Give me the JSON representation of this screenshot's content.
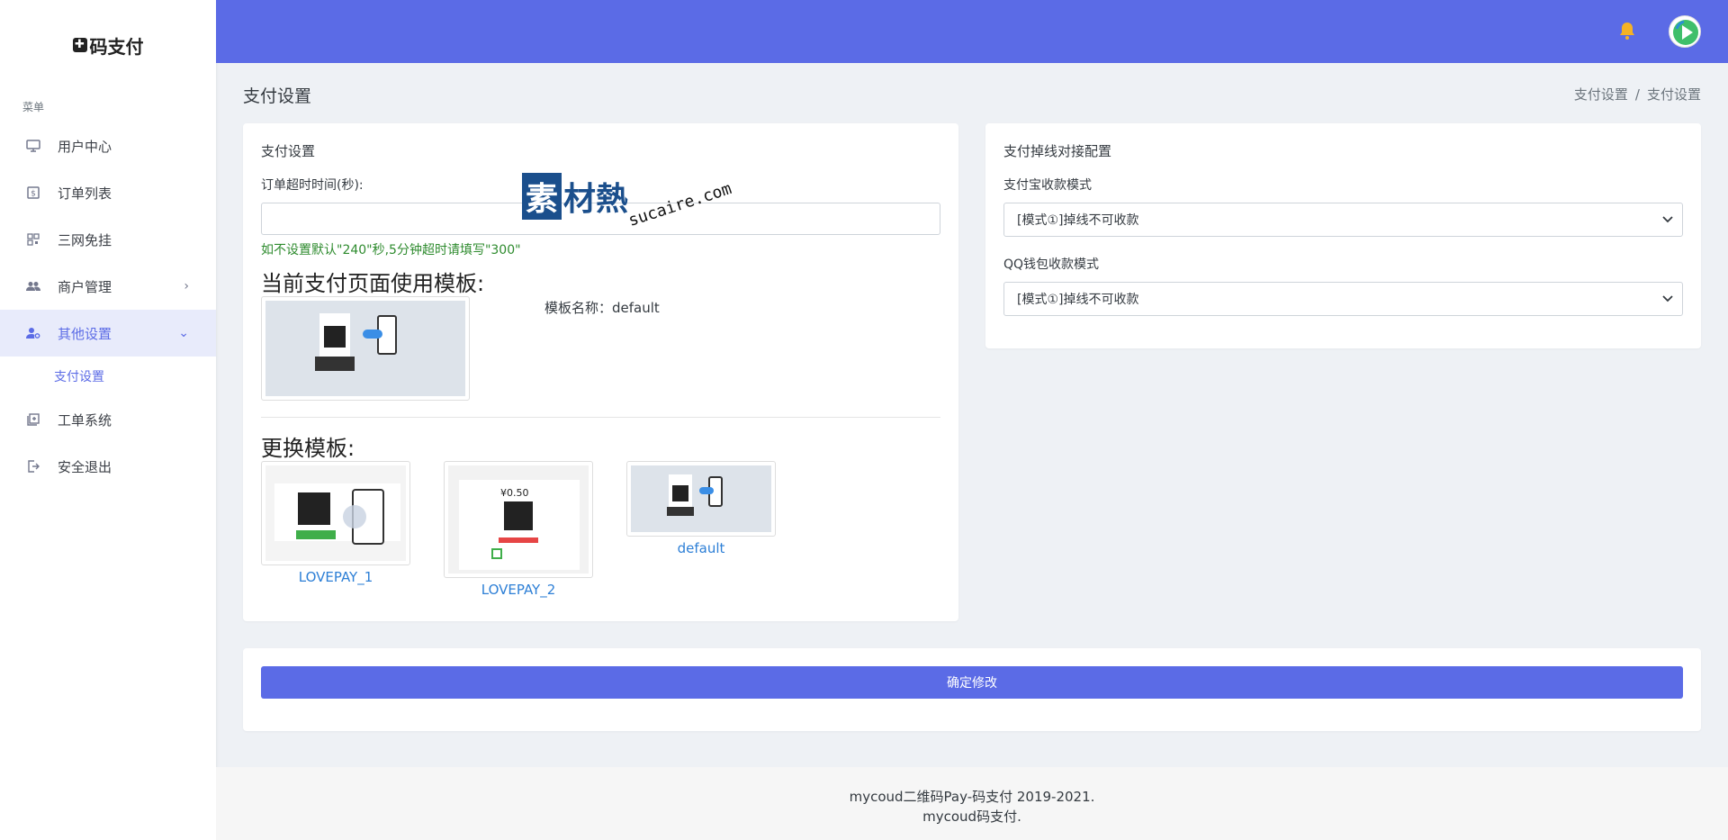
{
  "brand": {
    "name": "码支付",
    "mark": "✚"
  },
  "sidebar": {
    "menu_title": "菜单",
    "items": [
      {
        "label": "用户中心",
        "icon": "monitor-icon"
      },
      {
        "label": "订单列表",
        "icon": "dollar-receipt-icon"
      },
      {
        "label": "三网免挂",
        "icon": "qrcode-icon"
      },
      {
        "label": "商户管理",
        "icon": "users-icon"
      },
      {
        "label": "其他设置",
        "icon": "user-settings-icon"
      },
      {
        "label": "工单系统",
        "icon": "ticket-icon"
      },
      {
        "label": "安全退出",
        "icon": "logout-icon"
      }
    ],
    "submenu": {
      "label": "支付设置"
    }
  },
  "header": {
    "accent": "#5b6be6"
  },
  "page": {
    "title": "支付设置",
    "breadcrumb": [
      "支付设置",
      "支付设置"
    ],
    "breadcrumb_sep": "/"
  },
  "pay_settings": {
    "card_title": "支付设置",
    "timeout_label": "订单超时时间(秒):",
    "timeout_value": "",
    "timeout_help": "如不设置默认\"240\"秒,5分钟超时请填写\"300\"",
    "current_heading": "当前支付页面使用模板:",
    "template_name_label": "模板名称：default",
    "change_heading": "更换模板:",
    "templates": [
      {
        "name": "LOVEPAY_1"
      },
      {
        "name": "LOVEPAY_2",
        "amount": "¥0.50"
      },
      {
        "name": "default"
      }
    ]
  },
  "offline_config": {
    "card_title": "支付掉线对接配置",
    "alipay_label": "支付宝收款模式",
    "alipay_value": "[模式①]掉线不可收款",
    "qq_label": "QQ钱包收款模式",
    "qq_value": "[模式①]掉线不可收款"
  },
  "submit_label": "确定修改",
  "footer": {
    "line1": "mycoud二维码Pay-码支付 2019-2021.",
    "line2": "mycoud码支付."
  },
  "watermark": {
    "brand": "素",
    "chars": "材熱",
    "url": "sucaire.com"
  }
}
